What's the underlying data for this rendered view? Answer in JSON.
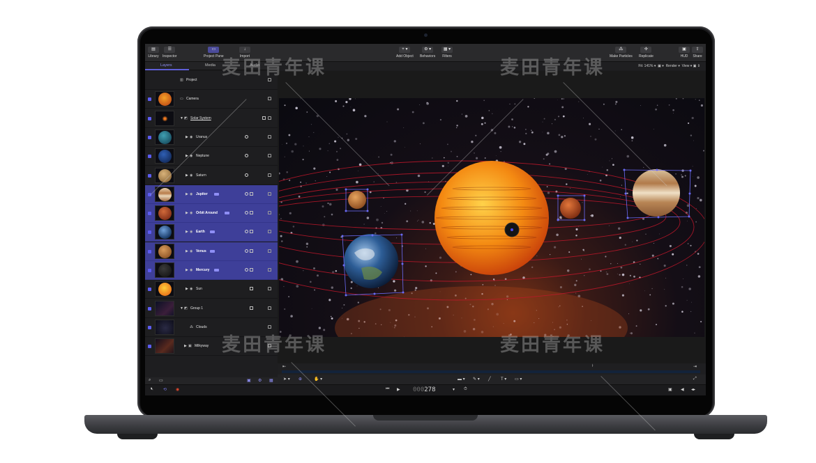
{
  "toolbar": {
    "library": "Library",
    "inspector": "Inspector",
    "project_pane": "Project Pane",
    "import": "Import",
    "add_object": "Add Object",
    "behaviors": "Behaviors",
    "filters": "Filters",
    "make_particles": "Make Particles",
    "replicate": "Replicate",
    "hud": "HUD",
    "share": "Share"
  },
  "tabs": [
    {
      "label": "Layers",
      "active": true
    },
    {
      "label": "Media",
      "active": false
    },
    {
      "label": "Audio",
      "active": false
    }
  ],
  "canvas": {
    "fit": "Fit: 141%",
    "render": "Render",
    "view": "View"
  },
  "layers": [
    {
      "name": "Project",
      "icon": "project-icon",
      "selected": false
    },
    {
      "name": "Camera",
      "icon": "camera-icon",
      "selected": false
    },
    {
      "name": "Solar System",
      "icon": "group-icon",
      "selected": false
    },
    {
      "name": "Uranus",
      "icon": "sphere-icon",
      "selected": false
    },
    {
      "name": "Neptune",
      "icon": "sphere-icon",
      "selected": false
    },
    {
      "name": "Saturn",
      "icon": "sphere-icon",
      "selected": false
    },
    {
      "name": "Jupiter",
      "icon": "sphere-icon",
      "selected": true
    },
    {
      "name": "Orbit Around",
      "icon": "sphere-icon",
      "selected": true
    },
    {
      "name": "Earth",
      "icon": "sphere-icon",
      "selected": true
    },
    {
      "name": "Venus",
      "icon": "sphere-icon",
      "selected": true
    },
    {
      "name": "Mercury",
      "icon": "sphere-icon",
      "selected": true
    },
    {
      "name": "Sun",
      "icon": "sphere-icon",
      "selected": false
    },
    {
      "name": "Group 1",
      "icon": "group-icon",
      "selected": false
    },
    {
      "name": "Clouds",
      "icon": "particles-icon",
      "selected": false
    },
    {
      "name": "Milkyway",
      "icon": "image-icon",
      "selected": false
    }
  ],
  "transport": {
    "timecode_dim": "000",
    "timecode": "278"
  },
  "watermark": "麦田青年课",
  "colors": {
    "accent": "#5f5fd8",
    "selection": "#3e3f99",
    "orbit": "#c0182a",
    "sun": "#f08a12"
  }
}
